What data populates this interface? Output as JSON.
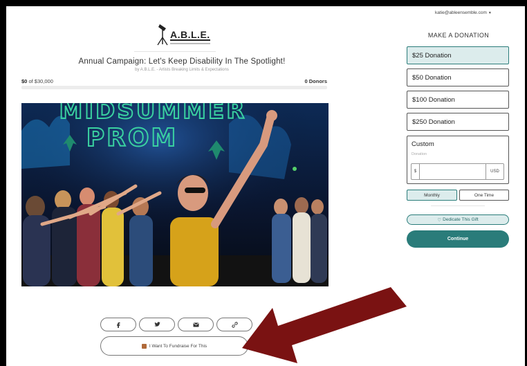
{
  "header": {
    "account_email": "katie@ableensemble.com",
    "logo_text": "A.B.L.E."
  },
  "campaign": {
    "title": "Annual Campaign: Let's Keep Disability In The Spotlight!",
    "by_line": "by A.B.L.E. - Artists Breaking Limits & Expectations",
    "raised_amount": "$0",
    "raised_of": "of $30,000",
    "donors_label": "0 Donors",
    "progress_fraction": 0,
    "hero_sign_text": "MIDSUMMER PROM"
  },
  "share": {
    "buttons": [
      {
        "name": "facebook-icon",
        "glyph": "f"
      },
      {
        "name": "twitter-icon",
        "glyph": "🐦"
      },
      {
        "name": "email-icon",
        "glyph": "✉"
      },
      {
        "name": "link-icon",
        "glyph": "🔗"
      }
    ],
    "fundraise_label": "I Want To Fundraise For This"
  },
  "donation": {
    "heading": "MAKE A DONATION",
    "amounts": [
      {
        "label": "$25 Donation",
        "selected": true
      },
      {
        "label": "$50 Donation",
        "selected": false
      },
      {
        "label": "$100 Donation",
        "selected": false
      },
      {
        "label": "$250 Donation",
        "selected": false
      }
    ],
    "custom": {
      "label": "Custom",
      "sub_label": "Donation",
      "currency_symbol": "$",
      "currency_code": "USD",
      "value": ""
    },
    "frequency": [
      {
        "label": "Monthly",
        "selected": true
      },
      {
        "label": "One Time",
        "selected": false
      }
    ],
    "dedicate_label": "Dedicate This Gift",
    "continue_label": "Continue"
  },
  "colors": {
    "accent": "#2a7c7a",
    "accent_light": "#dcecec",
    "arrow": "#7a1212"
  }
}
